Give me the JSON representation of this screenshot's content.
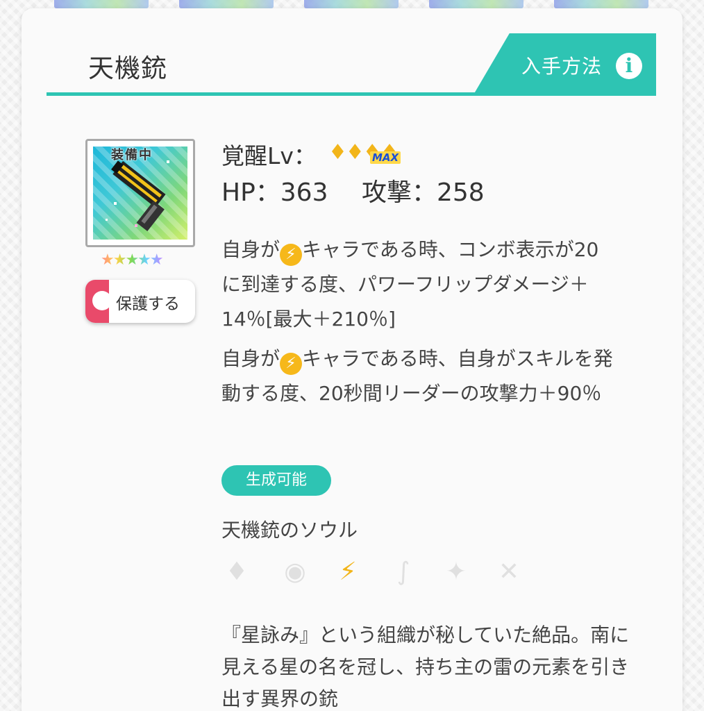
{
  "item": {
    "title": "天機銃",
    "acquire_label": "入手方法",
    "info_glyph": "i",
    "equipped_badge": "装備中",
    "stars": "★★★★★",
    "protect_label": "保護する",
    "awaken_label": "覚醒Lv：",
    "awaken_gems": "♦♦♦♦",
    "awaken_max": "MAX",
    "hp_text": "HP：363",
    "attack_text": "攻撃：258",
    "skills": [
      {
        "prefix": "自身が",
        "element_glyph": "⚡",
        "rest": "キャラである時、コンボ表示が20 に到達する度、パワーフリップダメージ＋14％[最大＋210％]"
      },
      {
        "prefix": "自身が",
        "element_glyph": "⚡",
        "rest": "キャラである時、自身がスキルを発動する度、20秒間リーダーの攻撃力＋90％"
      }
    ],
    "craftable_badge": "生成可能",
    "soul_name": "天機銃のソウル",
    "elements": [
      {
        "icon": "fire-icon",
        "glyph": "♦",
        "active": false
      },
      {
        "icon": "water-icon",
        "glyph": "◉",
        "active": false
      },
      {
        "icon": "thunder-icon",
        "glyph": "⚡",
        "active": true
      },
      {
        "icon": "wind-icon",
        "glyph": "∫",
        "active": false
      },
      {
        "icon": "light-icon",
        "glyph": "✦",
        "active": false
      },
      {
        "icon": "dark-icon",
        "glyph": "✕",
        "active": false
      }
    ],
    "flavor_text": "『星詠み』という組織が秘していた絶品。南に見える星の名を冠し、持ち主の雷の元素を引き出す異界の銃"
  },
  "colors": {
    "accent": "#2ec4b3",
    "protect_toggle": "#e94a6a",
    "thunder": "#f2b51a"
  }
}
